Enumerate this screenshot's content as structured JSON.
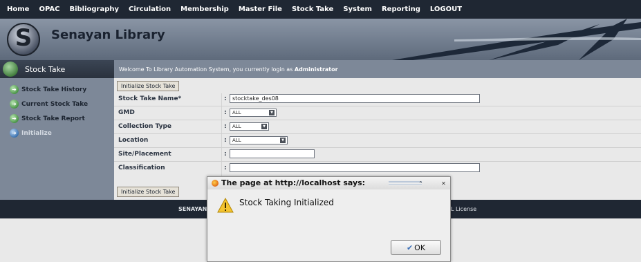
{
  "topnav": {
    "items": [
      "Home",
      "OPAC",
      "Bibliography",
      "Circulation",
      "Membership",
      "Master File",
      "Stock Take",
      "System",
      "Reporting",
      "LOGOUT"
    ]
  },
  "banner": {
    "title": "Senayan Library",
    "logo_letter": "S"
  },
  "sidebar": {
    "heading": "Stock Take",
    "items": [
      {
        "label": "Stock Take History",
        "icon": "arrow-right-icon"
      },
      {
        "label": "Current Stock Take",
        "icon": "arrow-right-icon"
      },
      {
        "label": "Stock Take Report",
        "icon": "arrow-right-icon"
      },
      {
        "label": "Initialize",
        "icon": "arrow-right-icon"
      }
    ]
  },
  "welcome": {
    "text": "Welcome To Library Automation System, you currently login as",
    "user": "Administrator"
  },
  "form": {
    "init_button": "Initialize Stock Take",
    "fields": {
      "name_label": "Stock Take Name*",
      "name_value": "stocktake_des08",
      "gmd_label": "GMD",
      "gmd_value": "ALL",
      "coltype_label": "Collection Type",
      "coltype_value": "ALL",
      "location_label": "Location",
      "location_value": "ALL",
      "site_label": "Site/Placement",
      "site_value": "",
      "class_label": "Classification",
      "class_value": ""
    },
    "colon": ":"
  },
  "footer": {
    "left": "SENAYAN",
    "right": "L License"
  },
  "dialog": {
    "title": "The page at http://localhost says:",
    "message": "Stock Taking Initialized",
    "ok_label": "OK",
    "minimize_glyph": "⌃",
    "close_glyph": "✕"
  }
}
